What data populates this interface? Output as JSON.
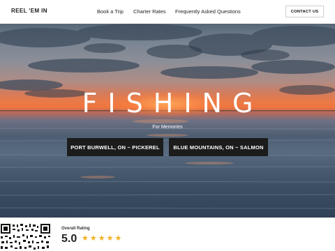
{
  "nav": {
    "brand": "REEL 'EM IN",
    "links": [
      "Book a Trip",
      "Charter Rates",
      "Frequently Asked Questions"
    ],
    "contact_label": "CONTACT US"
  },
  "hero": {
    "title": "FISHING",
    "subtitle": "For Memories",
    "buttons": [
      "PORT BURWELL, ON ~ PICKEREL",
      "BLUE MOUNTAINS, ON ~ SALMON"
    ]
  },
  "rating": {
    "label": "Overall Rating",
    "value": "5.0",
    "stars": 5,
    "star_icon": "star-icon",
    "star_color": "#f2b01e"
  },
  "colors": {
    "button_bg": "#1c1c1c",
    "sunset": "#f0753e"
  }
}
